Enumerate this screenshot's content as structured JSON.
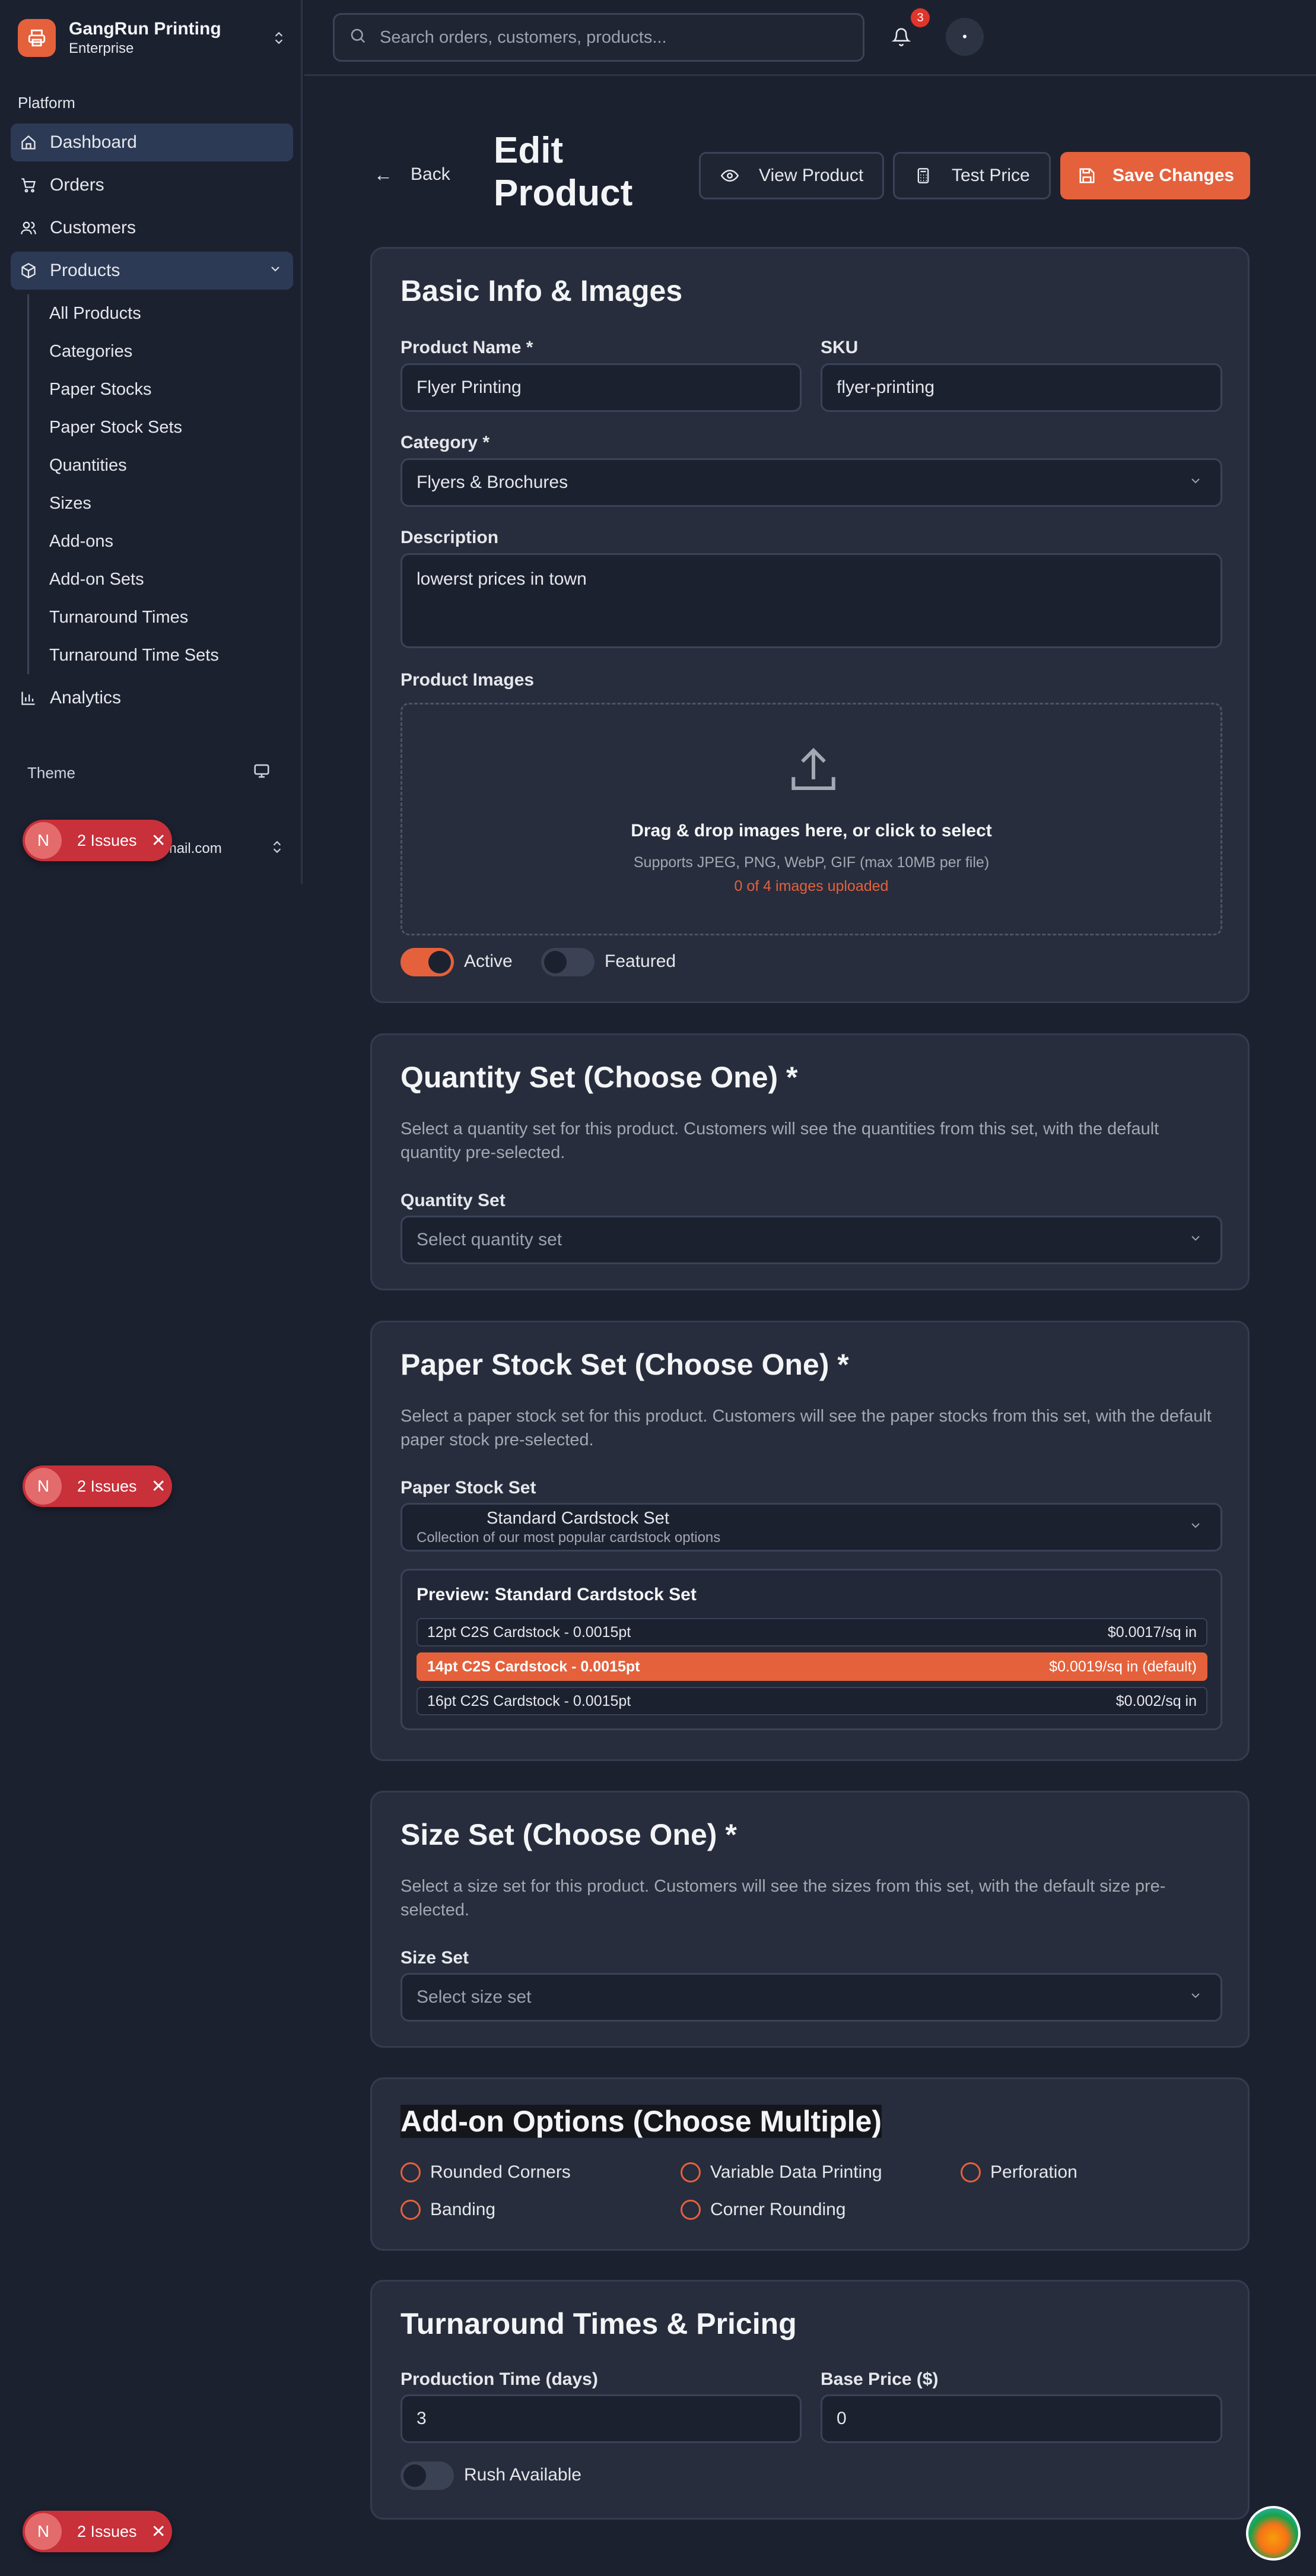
{
  "brand": {
    "name": "GangRun Printing",
    "plan": "Enterprise"
  },
  "sidebar": {
    "section_label": "Platform",
    "items": [
      {
        "label": "Dashboard",
        "icon": "home-icon"
      },
      {
        "label": "Orders",
        "icon": "cart-icon"
      },
      {
        "label": "Customers",
        "icon": "users-icon"
      },
      {
        "label": "Products",
        "icon": "box-icon"
      }
    ],
    "product_subitems": [
      "All Products",
      "Categories",
      "Paper Stocks",
      "Paper Stock Sets",
      "Quantities",
      "Sizes",
      "Add-ons",
      "Add-on Sets",
      "Turnaround Times",
      "Turnaround Time Sets"
    ],
    "analytics_label": "Analytics",
    "theme_label": "Theme",
    "user_email": "@gmail.com"
  },
  "issues_badge": {
    "letter": "N",
    "label": "2 Issues"
  },
  "topbar": {
    "search_placeholder": "Search orders, customers, products...",
    "notification_count": "3",
    "avatar_initial": "•"
  },
  "header": {
    "back_label": "Back",
    "title": "Edit Product",
    "view_product_label": "View Product",
    "test_price_label": "Test Price",
    "save_label": "Save Changes"
  },
  "basic_info": {
    "title": "Basic Info & Images",
    "product_name_label": "Product Name *",
    "product_name_value": "Flyer Printing",
    "sku_label": "SKU",
    "sku_value": "flyer-printing",
    "category_label": "Category *",
    "category_value": "Flyers & Brochures",
    "description_label": "Description",
    "description_value": "lowerst prices in town",
    "images_label": "Product Images",
    "dropzone_title": "Drag & drop images here, or click to select",
    "dropzone_sub": "Supports JPEG, PNG, WebP, GIF (max 10MB per file)",
    "dropzone_count": "0 of 4 images uploaded",
    "active_label": "Active",
    "active_on": true,
    "featured_label": "Featured",
    "featured_on": false
  },
  "quantity_set": {
    "title": "Quantity Set (Choose One) *",
    "description": "Select a quantity set for this product. Customers will see the quantities from this set, with the default quantity pre-selected.",
    "field_label": "Quantity Set",
    "placeholder": "Select quantity set"
  },
  "paper_stock_set": {
    "title": "Paper Stock Set (Choose One) *",
    "description": "Select a paper stock set for this product. Customers will see the paper stocks from this set, with the default paper stock pre-selected.",
    "field_label": "Paper Stock Set",
    "selected_name": "Standard Cardstock Set",
    "selected_desc": "Collection of our most popular cardstock options",
    "preview_title": "Preview: Standard Cardstock Set",
    "stocks": [
      {
        "name": "12pt C2S Cardstock - 0.0015pt",
        "price": "$0.0017/sq in",
        "selected": false
      },
      {
        "name": "14pt C2S Cardstock - 0.0015pt",
        "price": "$0.0019/sq in (default)",
        "selected": true
      },
      {
        "name": "16pt C2S Cardstock - 0.0015pt",
        "price": "$0.002/sq in",
        "selected": false
      }
    ]
  },
  "size_set": {
    "title": "Size Set (Choose One) *",
    "description": "Select a size set for this product. Customers will see the sizes from this set, with the default size pre-selected.",
    "field_label": "Size Set",
    "placeholder": "Select size set"
  },
  "addons": {
    "title": "Add-on Options (Choose Multiple)",
    "options": [
      "Rounded Corners",
      "Variable Data Printing",
      "Perforation",
      "Banding",
      "Corner Rounding"
    ]
  },
  "turnaround": {
    "title": "Turnaround Times & Pricing",
    "production_label": "Production Time (days)",
    "production_value": "3",
    "base_price_label": "Base Price ($)",
    "base_price_value": "0",
    "rush_label": "Rush Available",
    "rush_on": false
  },
  "colors": {
    "accent": "#e4613c",
    "background": "#1c2130",
    "card": "#272d3c",
    "badge": "#c8303a"
  }
}
